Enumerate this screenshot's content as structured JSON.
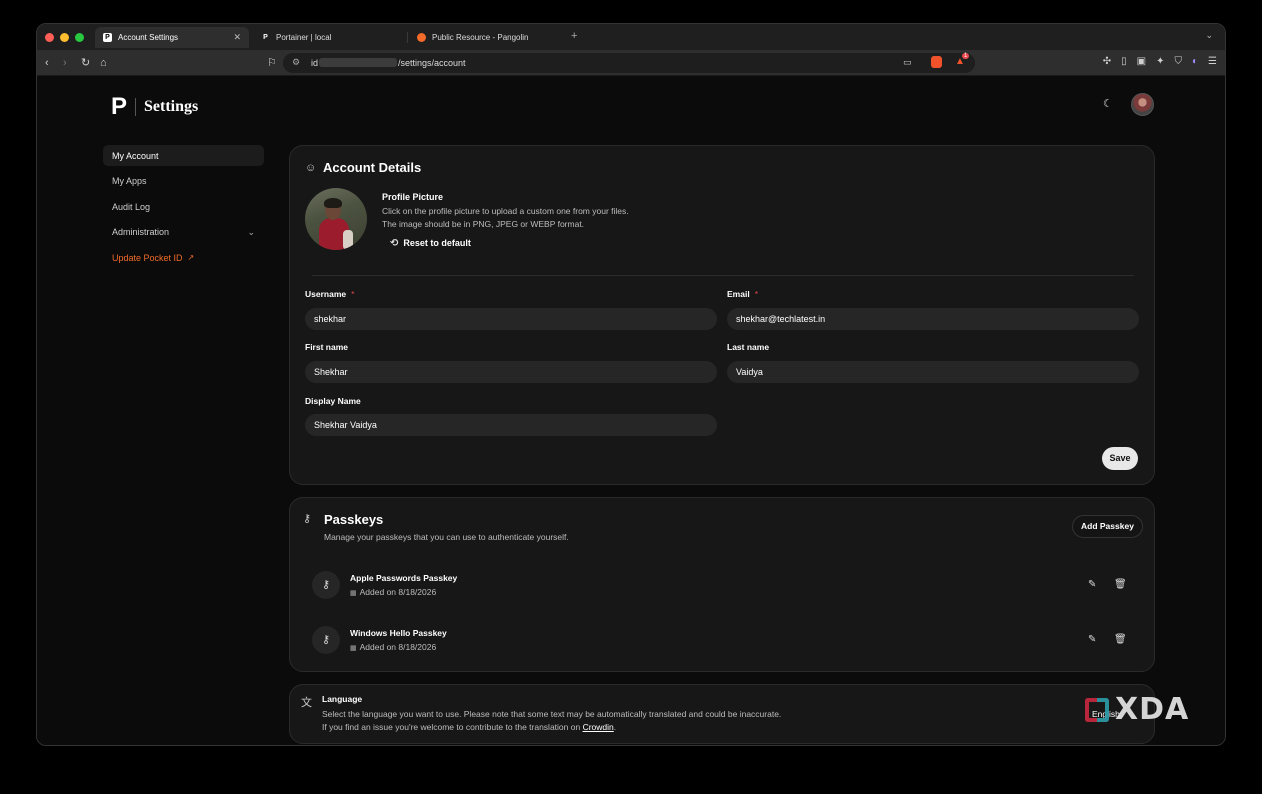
{
  "browser": {
    "tabs": [
      {
        "label": "Account Settings",
        "favicon": "P",
        "active": true
      },
      {
        "label": "Portainer | local",
        "favicon": "P",
        "active": false
      },
      {
        "label": "Public Resource - Pangolin",
        "favicon": "pangolin",
        "active": false
      }
    ],
    "url_prefix": "id",
    "url_path": "/settings/account",
    "shield_badge": "1"
  },
  "header": {
    "logo_letter": "P",
    "logo_text": "Settings"
  },
  "sidebar": {
    "items": [
      {
        "label": "My Account"
      },
      {
        "label": "My Apps"
      },
      {
        "label": "Audit Log"
      },
      {
        "label": "Administration"
      },
      {
        "label": "Update Pocket ID"
      }
    ]
  },
  "account": {
    "title": "Account Details",
    "profile_picture_title": "Profile Picture",
    "profile_picture_desc_1": "Click on the profile picture to upload a custom one from your files.",
    "profile_picture_desc_2": "The image should be in PNG, JPEG or WEBP format.",
    "reset_label": "Reset to default",
    "fields": {
      "username_label": "Username",
      "username_value": "shekhar",
      "email_label": "Email",
      "email_value": "shekhar@techlatest.in",
      "first_name_label": "First name",
      "first_name_value": "Shekhar",
      "last_name_label": "Last name",
      "last_name_value": "Vaidya",
      "display_name_label": "Display Name",
      "display_name_value": "Shekhar Vaidya",
      "required_mark": "*"
    },
    "save_label": "Save"
  },
  "passkeys": {
    "title": "Passkeys",
    "description": "Manage your passkeys that you can use to authenticate yourself.",
    "add_label": "Add Passkey",
    "items": [
      {
        "name": "Apple Passwords Passkey",
        "added": "Added on 8/18/2026"
      },
      {
        "name": "Windows Hello Passkey",
        "added": "Added on 8/18/2026"
      }
    ]
  },
  "language": {
    "title": "Language",
    "desc_1": "Select the language you want to use. Please note that some text may be automatically translated and could be inaccurate.",
    "desc_2_prefix": "If you find an issue you're welcome to contribute to the translation on ",
    "desc_2_link": "Crowdin",
    "desc_2_suffix": ".",
    "value": "English"
  },
  "watermark": {
    "text": "XDA"
  },
  "colors": {
    "accent_orange": "#f26b2a",
    "required_red": "#e5484d",
    "xda_red": "#c5283d",
    "xda_teal": "#2e9aa8"
  }
}
